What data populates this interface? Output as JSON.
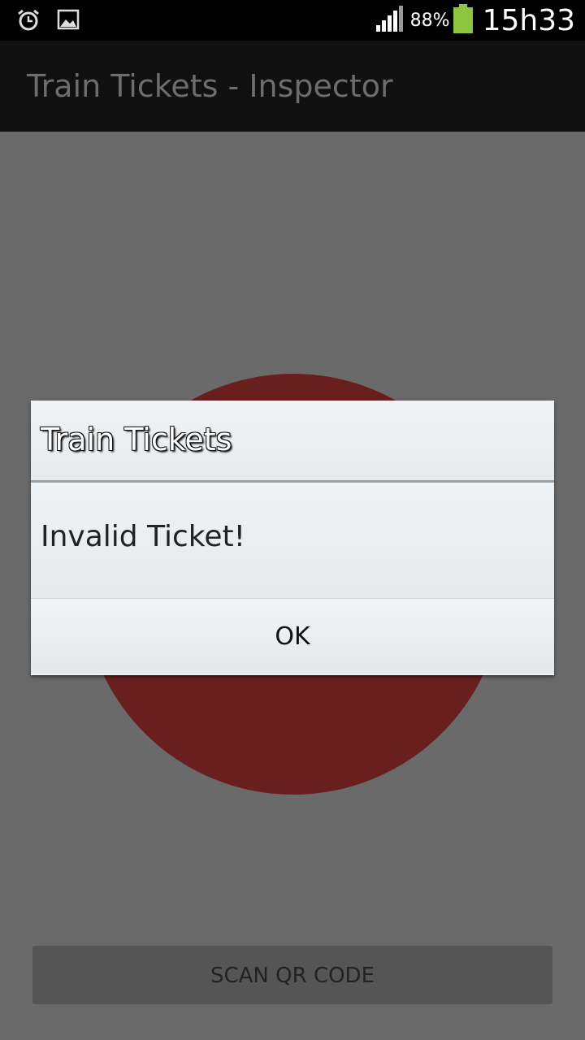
{
  "status_bar": {
    "battery_percent": "88%",
    "time": "15h33",
    "icons": [
      "alarm-icon",
      "image-icon",
      "signal-icon",
      "battery-icon"
    ],
    "battery_color": "#8cc63f"
  },
  "action_bar": {
    "title": "Train Tickets - Inspector"
  },
  "main": {
    "status_circle_color": "#6a1f1f",
    "scan_button_label": "SCAN QR CODE"
  },
  "dialog": {
    "title": "Train Tickets",
    "message": "Invalid Ticket!",
    "ok_label": "OK"
  }
}
